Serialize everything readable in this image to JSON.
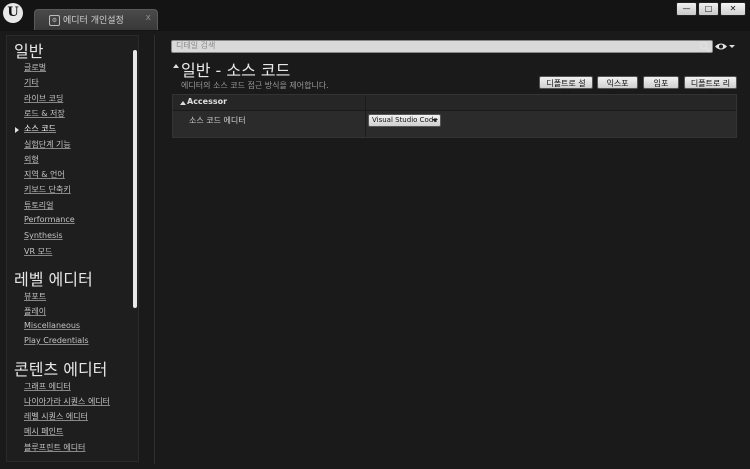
{
  "window": {
    "tab_title": "에디터 개인설정",
    "tab_close": "x",
    "logo_glyph": "U",
    "controls": {
      "minimize": "—",
      "maximize": "□",
      "close": "✕"
    }
  },
  "sidebar": {
    "sections": [
      {
        "title": "일반",
        "items": [
          "글로벌",
          "기타",
          "라이브 코딩",
          "로드 & 저장",
          "소스 코드",
          "실험단계 기능",
          "외형",
          "지역 & 언어",
          "키보드 단축키",
          "튜토리얼",
          "Performance",
          "Synthesis",
          "VR 모드"
        ]
      },
      {
        "title": "레벨 에디터",
        "items": [
          "뷰포트",
          "플레이",
          "Miscellaneous",
          "Play Credentials"
        ]
      },
      {
        "title": "콘텐츠 에디터",
        "items": [
          "그래프 에디터",
          "나이아가라 시퀀스 에디터",
          "레벨 시퀀스 에디터",
          "메시 페인트",
          "블루프린트 에디터"
        ]
      }
    ],
    "active_item": "소스 코드"
  },
  "search": {
    "placeholder": "디테일 검색"
  },
  "main": {
    "title": "일반 - 소스 코드",
    "description": "에디터의 소스 코드 접근 방식을 제어합니다.",
    "buttons": {
      "set_default": "디폴트로 설정",
      "export": "익스포트...",
      "import": "임포트...",
      "reset_default": "디폴트로 리셋"
    },
    "category": "Accessor",
    "property": {
      "label": "소스 코드 에디터",
      "value": "Visual Studio Code"
    }
  },
  "colors": {
    "background": "#1a1a1a",
    "panel": "#2b2b2b",
    "button": "#dcdcdc"
  }
}
